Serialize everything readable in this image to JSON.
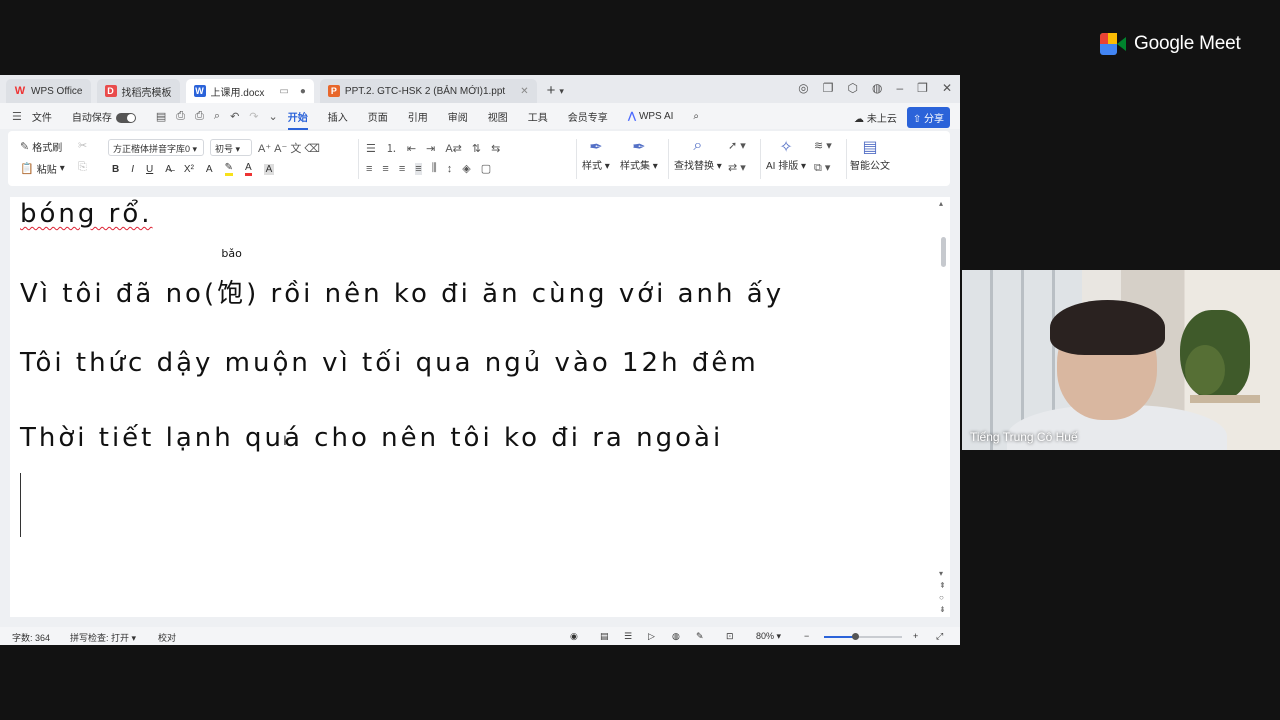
{
  "meet": {
    "brand": "Google Meet",
    "participant_name": "Tiếng Trung Cô Huế"
  },
  "tabs": [
    {
      "label": "WPS Office",
      "icon": "wps-logo-icon",
      "active": false
    },
    {
      "label": "找稻壳模板",
      "icon": "docer-icon",
      "active": false
    },
    {
      "label": "上课用.docx",
      "icon": "word-doc-icon",
      "active": true
    },
    {
      "label": "PPT.2. GTC-HSK 2 (BẢN MỚI)1.ppt",
      "icon": "ppt-icon",
      "active": false
    }
  ],
  "menu": {
    "file": "文件",
    "autosave": "自动保存",
    "items": [
      "开始",
      "插入",
      "页面",
      "引用",
      "审阅",
      "视图",
      "工具",
      "会员专享"
    ],
    "active": "开始",
    "wps_ai": "WPS AI",
    "cloud": "未上云",
    "share": "分享"
  },
  "ribbon": {
    "format_painter": "格式刷",
    "paste": "粘贴",
    "font_name": "方正楷体拼音字库0",
    "font_size": "初号",
    "styles": "样式",
    "style_set": "样式集",
    "find_replace": "查找替换",
    "ai_layout": "AI 排版",
    "smart_doc": "智能公文"
  },
  "document": {
    "line1": "bóng rổ.",
    "line2_pre": "Vì tôi đã no(",
    "line2_hanzi": "饱",
    "line2_pinyin": "bǎo",
    "line2_post": ") rồi nên ko đi ăn cùng với anh ấy",
    "line3": "Tôi thức dậy muộn vì tối qua ngủ vào 12h đêm",
    "line4": "Thời tiết lạnh quá cho nên tôi ko đi ra ngoài"
  },
  "status": {
    "word_count": "字数: 364",
    "spell_check": "拼写检查: 打开",
    "proofread": "校对",
    "zoom": "80%"
  }
}
